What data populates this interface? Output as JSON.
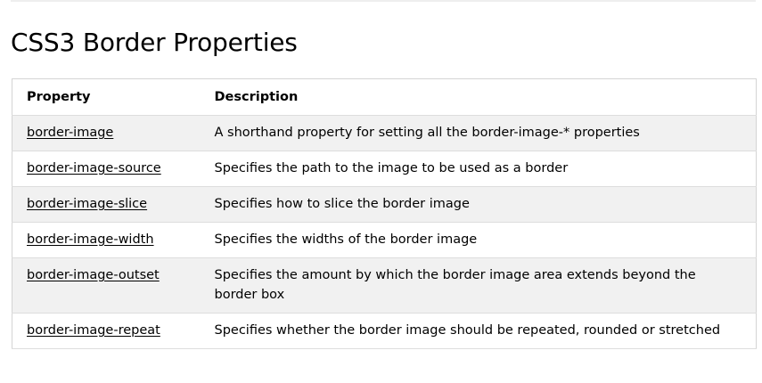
{
  "page": {
    "title": "CSS3 Border Properties"
  },
  "table": {
    "headers": {
      "property": "Property",
      "description": "Description"
    },
    "rows": [
      {
        "property": "border-image",
        "description": "A shorthand property for setting all the border-image-* properties"
      },
      {
        "property": "border-image-source",
        "description": "Specifies the path to the image to be used as a border"
      },
      {
        "property": "border-image-slice",
        "description": "Specifies how to slice the border image"
      },
      {
        "property": "border-image-width",
        "description": "Specifies the widths of the border image"
      },
      {
        "property": "border-image-outset",
        "description": "Specifies the amount by which the border image area extends beyond the border box"
      },
      {
        "property": "border-image-repeat",
        "description": "Specifies whether the border image should be repeated, rounded or stretched"
      }
    ]
  },
  "colors": {
    "row_stripe": "#f1f1f1",
    "border": "#d4d4d4",
    "text": "#000000"
  }
}
